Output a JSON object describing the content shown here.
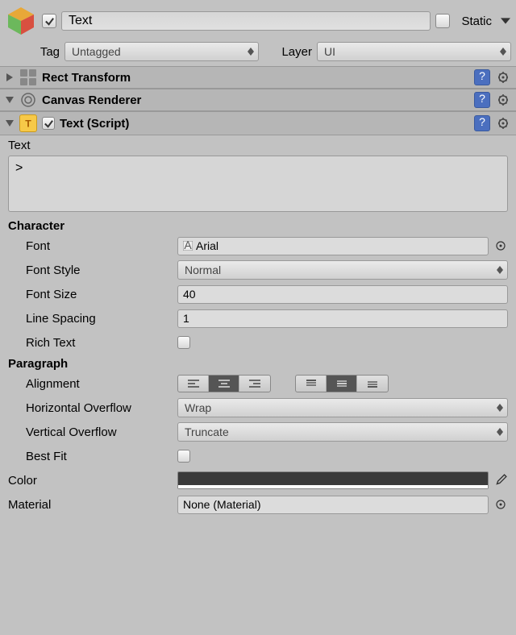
{
  "header": {
    "name": "Text",
    "name_enabled": true,
    "static_label": "Static",
    "static_checked": false
  },
  "tagging": {
    "tag_label": "Tag",
    "tag_value": "Untagged",
    "layer_label": "Layer",
    "layer_value": "UI"
  },
  "components": [
    {
      "title": "Rect Transform",
      "expanded": false,
      "type": "rect"
    },
    {
      "title": "Canvas Renderer",
      "expanded": true,
      "type": "canvas"
    },
    {
      "title": "Text (Script)",
      "expanded": true,
      "type": "text",
      "enabled": true
    }
  ],
  "text_component": {
    "text_label": "Text",
    "text_value": ">",
    "character": {
      "header": "Character",
      "font_label": "Font",
      "font_value": "Arial",
      "font_style_label": "Font Style",
      "font_style_value": "Normal",
      "font_size_label": "Font Size",
      "font_size_value": "40",
      "line_spacing_label": "Line Spacing",
      "line_spacing_value": "1",
      "rich_text_label": "Rich Text",
      "rich_text_checked": false
    },
    "paragraph": {
      "header": "Paragraph",
      "alignment_label": "Alignment",
      "h_overflow_label": "Horizontal Overflow",
      "h_overflow_value": "Wrap",
      "v_overflow_label": "Vertical Overflow",
      "v_overflow_value": "Truncate",
      "best_fit_label": "Best Fit",
      "best_fit_checked": false
    },
    "color_label": "Color",
    "color_value": "#3a3a3a",
    "material_label": "Material",
    "material_value": "None (Material)"
  }
}
